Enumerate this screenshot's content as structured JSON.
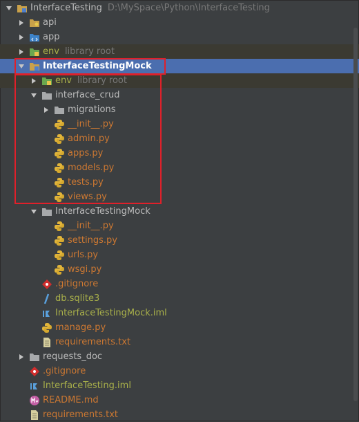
{
  "tree": [
    {
      "label": "InterfaceTesting",
      "extra": "D:\\MySpace\\Python\\InterfaceTesting",
      "icon": "project-folder-icon",
      "expanded": true
    },
    {
      "label": "api",
      "icon": "package-folder-icon",
      "expanded": false
    },
    {
      "label": "app",
      "icon": "source-folder-icon",
      "expanded": false
    },
    {
      "label": "env",
      "extra": "library root",
      "icon": "virtualenv-folder-icon",
      "expanded": false
    },
    {
      "label": "InterfaceTestingMock",
      "icon": "project-folder-icon",
      "expanded": true
    },
    {
      "label": "env",
      "extra": "library root",
      "icon": "virtualenv-folder-icon",
      "expanded": false
    },
    {
      "label": "interface_crud",
      "icon": "folder-icon",
      "expanded": true
    },
    {
      "label": "migrations",
      "icon": "folder-icon",
      "expanded": false
    },
    {
      "label": "__init__.py",
      "icon": "python-file-icon"
    },
    {
      "label": "admin.py",
      "icon": "python-file-icon"
    },
    {
      "label": "apps.py",
      "icon": "python-file-icon"
    },
    {
      "label": "models.py",
      "icon": "python-file-icon"
    },
    {
      "label": "tests.py",
      "icon": "python-file-icon"
    },
    {
      "label": "views.py",
      "icon": "python-file-icon"
    },
    {
      "label": "InterfaceTestingMock",
      "icon": "folder-icon",
      "expanded": true
    },
    {
      "label": "__init__.py",
      "icon": "python-file-icon"
    },
    {
      "label": "settings.py",
      "icon": "python-file-icon"
    },
    {
      "label": "urls.py",
      "icon": "python-file-icon"
    },
    {
      "label": "wsgi.py",
      "icon": "python-file-icon"
    },
    {
      "label": ".gitignore",
      "icon": "gitignore-file-icon"
    },
    {
      "label": "db.sqlite3",
      "icon": "database-file-icon"
    },
    {
      "label": "InterfaceTestingMock.iml",
      "icon": "iml-file-icon"
    },
    {
      "label": "manage.py",
      "icon": "python-file-icon"
    },
    {
      "label": "requirements.txt",
      "icon": "text-file-icon"
    },
    {
      "label": "requests_doc",
      "icon": "folder-icon",
      "expanded": false
    },
    {
      "label": ".gitignore",
      "icon": "gitignore-file-icon"
    },
    {
      "label": "InterfaceTesting.iml",
      "icon": "iml-file-icon"
    },
    {
      "label": "README.md",
      "icon": "markdown-file-icon"
    },
    {
      "label": "requirements.txt",
      "icon": "text-file-icon"
    }
  ]
}
